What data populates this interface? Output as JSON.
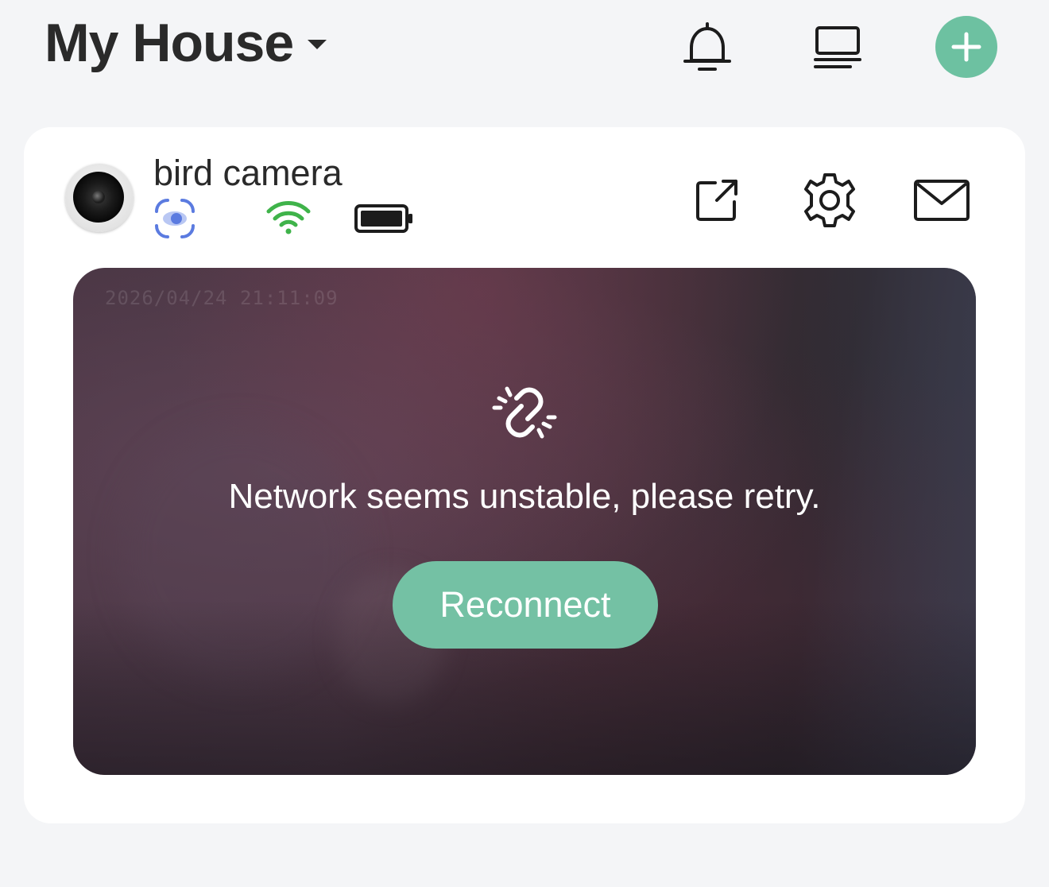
{
  "header": {
    "home_name": "My House",
    "icons": [
      "bell-icon",
      "monitor-icon",
      "plus-icon"
    ]
  },
  "device": {
    "name": "bird camera",
    "status_icons": [
      "motion-detection-icon",
      "wifi-icon",
      "battery-icon"
    ],
    "actions": [
      "share-icon",
      "gear-icon",
      "mail-icon"
    ],
    "overlay_timestamp": "2026/04/24 21:11:09",
    "error_message": "Network seems unstable, please retry.",
    "reconnect_label": "Reconnect"
  },
  "colors": {
    "accent": "#6dc1a1",
    "motion": "#5b7be0",
    "wifi": "#3fb34a",
    "text": "#2a2a2a",
    "background": "#f4f5f7"
  }
}
